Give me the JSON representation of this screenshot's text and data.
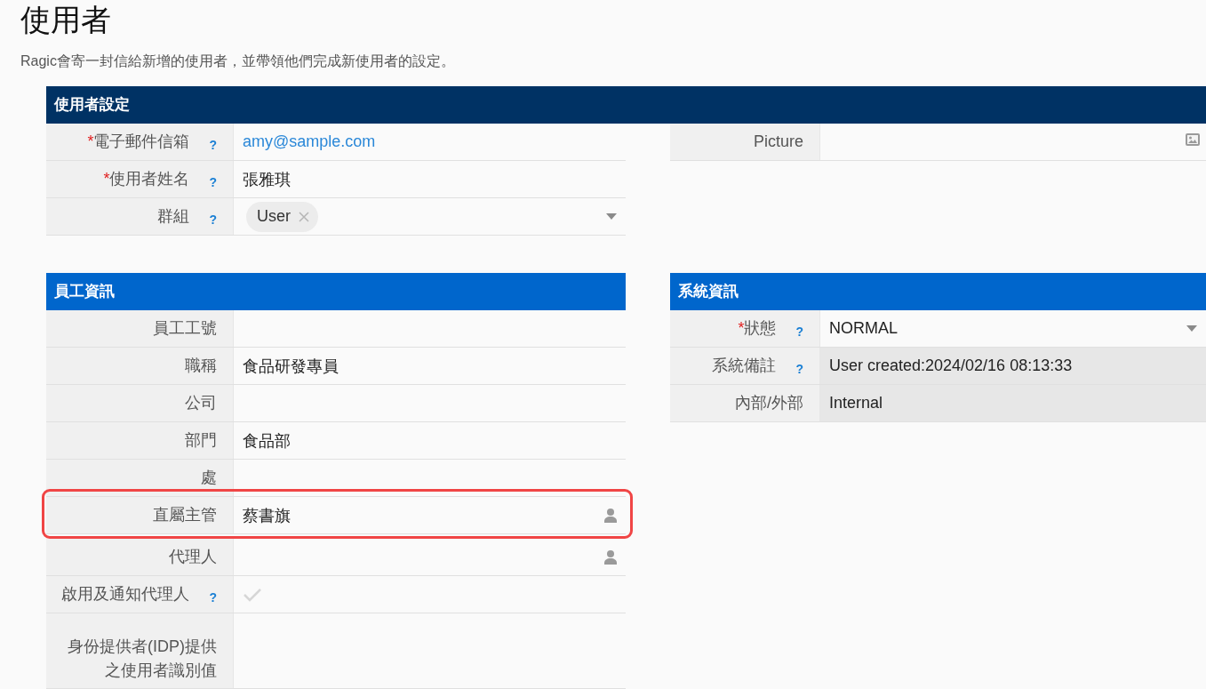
{
  "page": {
    "title": "使用者",
    "description": "Ragic會寄一封信給新增的使用者，並帶領他們完成新使用者的設定。"
  },
  "sections": [
    {
      "title": "使用者設定",
      "columns": [
        {
          "fields": [
            {
              "label": "電子郵件信箱",
              "required_mark": "*",
              "help": "?",
              "kind": "email",
              "value": "amy@sample.com"
            },
            {
              "label": "使用者姓名",
              "required_mark": "*",
              "help": "?",
              "kind": "text",
              "value": "張雅琪"
            },
            {
              "label": "群組",
              "help": "?",
              "kind": "tags",
              "tags": [
                "User"
              ]
            }
          ]
        },
        {
          "fields": [
            {
              "label": "Picture",
              "kind": "image"
            }
          ]
        }
      ]
    },
    {
      "columns": [
        {
          "title": "員工資訊",
          "fields": [
            {
              "label": "員工工號",
              "kind": "text",
              "highlighted": false
            },
            {
              "label": "職稱",
              "kind": "text",
              "value": "食品研發專員",
              "highlighted": false
            },
            {
              "label": "公司",
              "kind": "text",
              "highlighted": false
            },
            {
              "label": "部門",
              "kind": "text",
              "value": "食品部",
              "highlighted": false
            },
            {
              "label": "處",
              "kind": "text",
              "highlighted": false
            },
            {
              "label": "直屬主管",
              "kind": "user",
              "value": "蔡書旗",
              "highlighted": true
            },
            {
              "label": "代理人",
              "kind": "user",
              "highlighted": false
            },
            {
              "label": "啟用及通知代理人",
              "help": "?",
              "kind": "checkbox",
              "checked": false,
              "highlighted": false
            },
            {
              "label": "身份提供者(IDP)提供之使用者識別值",
              "kind": "text",
              "highlighted": false
            }
          ]
        },
        {
          "title": "系統資訊",
          "fields": [
            {
              "label": "狀態",
              "required_mark": "*",
              "help": "?",
              "kind": "select",
              "value": "NORMAL",
              "readonly": false
            },
            {
              "label": "系統備註",
              "help": "?",
              "kind": "text",
              "value": "User created:2024/02/16 08:13:33",
              "readonly": true
            },
            {
              "label": "內部/外部",
              "kind": "text",
              "value": "Internal",
              "readonly": true
            }
          ]
        }
      ]
    }
  ]
}
